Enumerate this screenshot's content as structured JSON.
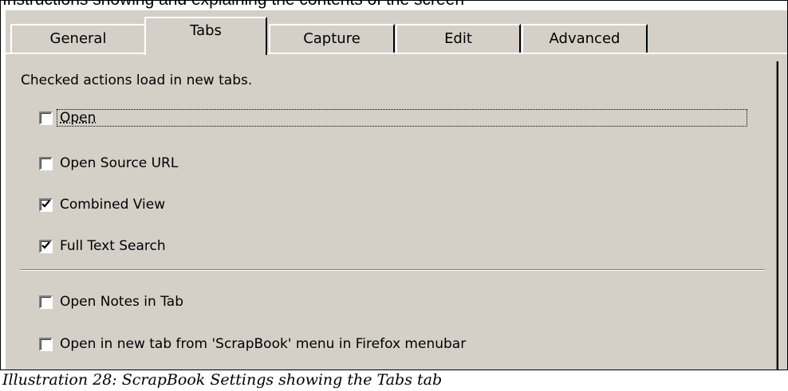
{
  "doc": {
    "clipped_heading": "Instructions showing and explaining the contents of the screen",
    "caption": "Illustration 28: ScrapBook Settings showing the Tabs tab"
  },
  "dialog": {
    "tabs": [
      {
        "label": "General",
        "active": false
      },
      {
        "label": "Tabs",
        "active": true
      },
      {
        "label": "Capture",
        "active": false
      },
      {
        "label": "Edit",
        "active": false
      },
      {
        "label": "Advanced",
        "active": false
      }
    ],
    "description": "Checked actions load in new tabs.",
    "group1": [
      {
        "label": "Open",
        "checked": false,
        "focused": true
      },
      {
        "label": "Open Source URL",
        "checked": false
      },
      {
        "label": "Combined View",
        "checked": true
      },
      {
        "label": "Full Text Search",
        "checked": true
      }
    ],
    "group2": [
      {
        "label": "Open Notes in Tab",
        "checked": false
      },
      {
        "label": "Open in new tab from 'ScrapBook' menu in Firefox menubar",
        "checked": false
      }
    ]
  },
  "colors": {
    "dialog_bg": "#d4d0c8",
    "check_mark": "#000000"
  }
}
